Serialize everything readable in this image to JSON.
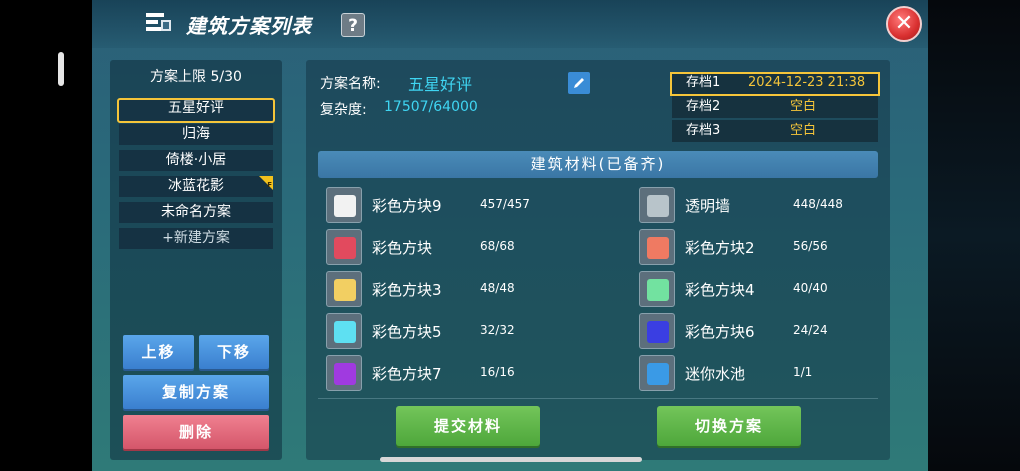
{
  "header": {
    "title": "建筑方案列表",
    "help_label": "?",
    "close_label": "✕"
  },
  "left": {
    "limit": "方案上限 5/30",
    "plans": [
      {
        "label": "五星好评",
        "selected": true
      },
      {
        "label": "归海"
      },
      {
        "label": "倚楼·小居"
      },
      {
        "label": "冰蓝花影",
        "badge": "F"
      },
      {
        "label": "未命名方案"
      },
      {
        "label": "+新建方案"
      }
    ],
    "move_up": "上移",
    "move_down": "下移",
    "copy": "复制方案",
    "delete": "删除"
  },
  "detail": {
    "name_label": "方案名称:",
    "name_value": "五星好评",
    "complexity_label": "复杂度:",
    "complexity_value": "17507/64000",
    "saves": [
      {
        "name": "存档1",
        "value": "2024-12-23 21:38"
      },
      {
        "name": "存档2",
        "value": "空白"
      },
      {
        "name": "存档3",
        "value": "空白"
      }
    ],
    "materials_title": "建筑材料(已备齐)",
    "materials": [
      {
        "name": "彩色方块9",
        "count": "457/457",
        "color": "#f2f2f2"
      },
      {
        "name": "透明墙",
        "count": "448/448",
        "color": "#b8c4ca"
      },
      {
        "name": "彩色方块",
        "count": "68/68",
        "color": "#e24a5e"
      },
      {
        "name": "彩色方块2",
        "count": "56/56",
        "color": "#ef7a62"
      },
      {
        "name": "彩色方块3",
        "count": "48/48",
        "color": "#f2cf62"
      },
      {
        "name": "彩色方块4",
        "count": "40/40",
        "color": "#72e2a0"
      },
      {
        "name": "彩色方块5",
        "count": "32/32",
        "color": "#5ee0f2"
      },
      {
        "name": "彩色方块6",
        "count": "24/24",
        "color": "#3a3ee2"
      },
      {
        "name": "彩色方块7",
        "count": "16/16",
        "color": "#a03ae0"
      },
      {
        "name": "迷你水池",
        "count": "1/1",
        "color": "#3a9ae6"
      }
    ],
    "submit": "提交材料",
    "switch": "切换方案"
  }
}
